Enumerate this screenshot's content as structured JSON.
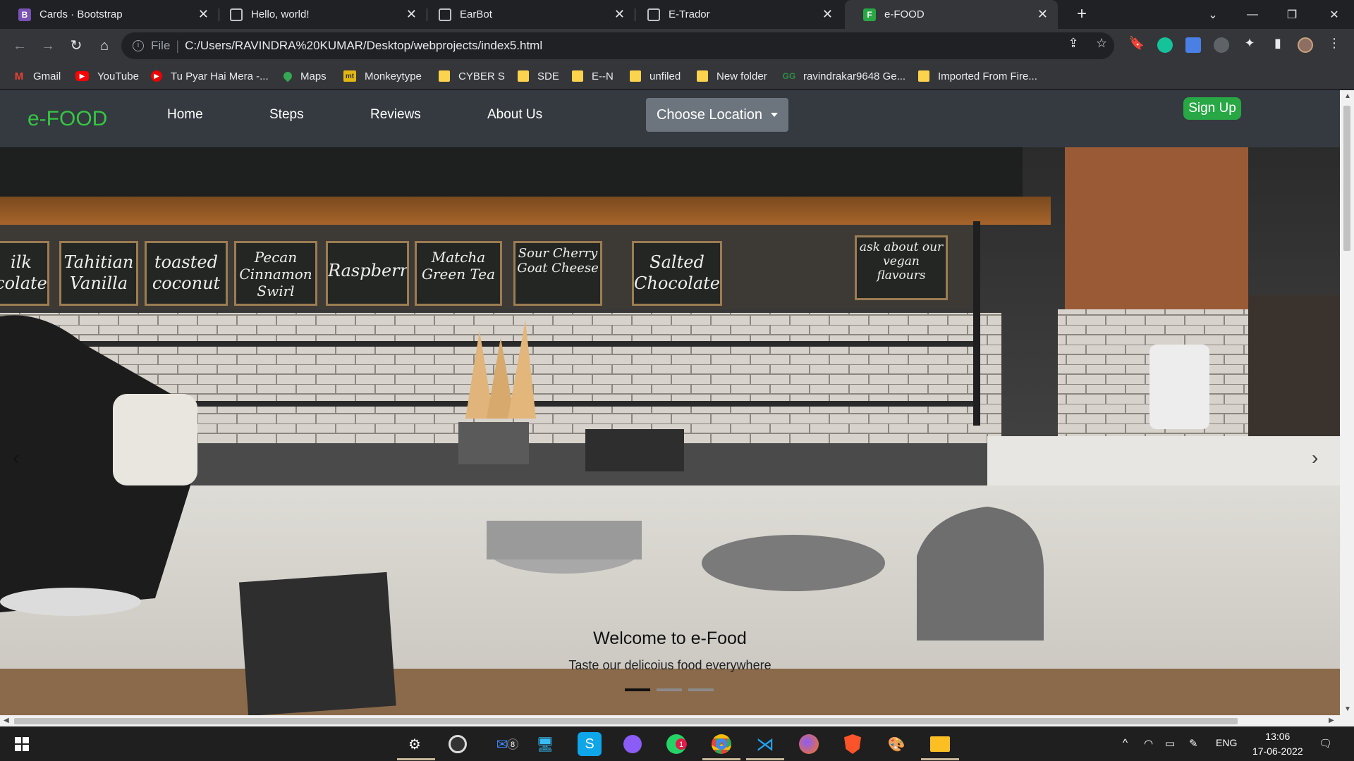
{
  "browser": {
    "tabs": [
      {
        "title": "Cards · Bootstrap",
        "favicon": "B",
        "favicon_color": "#7952b3"
      },
      {
        "title": "Hello, world!",
        "favicon": "globe"
      },
      {
        "title": "EarBot",
        "favicon": "globe"
      },
      {
        "title": "E-Trador",
        "favicon": "globe"
      },
      {
        "title": "e-FOOD",
        "favicon": "F",
        "favicon_color": "#28a745",
        "active": true
      }
    ],
    "new_tab": "+",
    "address": {
      "scheme": "File",
      "url": "C:/Users/RAVINDRA%20KUMAR/Desktop/webprojects/index5.html"
    },
    "bookmarks": [
      {
        "label": "Gmail",
        "icon": "gmail-icon"
      },
      {
        "label": "YouTube",
        "icon": "youtube-icon"
      },
      {
        "label": "Tu Pyar Hai Mera -...",
        "icon": "youtube-red-icon"
      },
      {
        "label": "Maps",
        "icon": "maps-icon"
      },
      {
        "label": "Monkeytype",
        "icon": "monkeytype-icon",
        "icon_text": "mt"
      },
      {
        "label": "CYBER S",
        "icon": "folder-icon"
      },
      {
        "label": "SDE",
        "icon": "folder-icon"
      },
      {
        "label": "E--N",
        "icon": "folder-icon"
      },
      {
        "label": "unfiled",
        "icon": "folder-icon"
      },
      {
        "label": "New folder",
        "icon": "folder-icon"
      },
      {
        "label": "ravindrakar9648 Ge...",
        "icon": "geeksforgeeks-icon"
      },
      {
        "label": "Imported From Fire...",
        "icon": "folder-icon"
      }
    ]
  },
  "site": {
    "brand": "e-FOOD",
    "nav": [
      "Home",
      "Steps",
      "Reviews",
      "About Us"
    ],
    "location_button": "Choose Location",
    "signup": "Sign Up",
    "brand_color": "#37c544"
  },
  "hero": {
    "chalkboards": [
      "ilk colate",
      "Tahitian Vanilla",
      "toasted coconut",
      "Pecan Cinnamon Swirl",
      "Raspberry",
      "Matcha Green Tea",
      "Sour Cherry Goat Cheese",
      "Salted Chocolate",
      "ask about our vegan flavours"
    ],
    "caption_title": "Welcome to e-Food",
    "caption_sub": "Taste our delicoius food everywhere",
    "slides": 3,
    "active_slide": 0
  },
  "taskbar": {
    "mail_badge": "8",
    "whatsapp_badge": "1",
    "language": "ENG",
    "time": "13:06",
    "date": "17-06-2022"
  }
}
